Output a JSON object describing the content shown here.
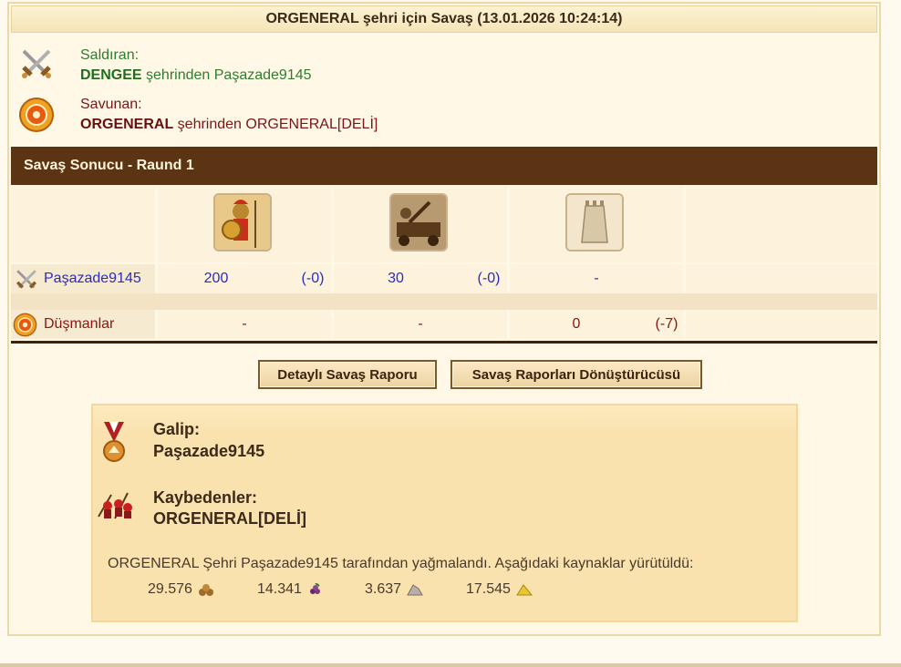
{
  "title": "ORGENERAL şehri için Savaş (13.01.2026 10:24:14)",
  "attacker": {
    "role": "Saldıran:",
    "city": "DENGEE",
    "middle": " şehrinden ",
    "player": "Paşazade9145"
  },
  "defender": {
    "role": "Savunan:",
    "city": "ORGENERAL",
    "middle": " şehrinden ",
    "player": "ORGENERAL[DELİ]"
  },
  "round_title": "Savaş Sonucu - Raund 1",
  "units": [
    {
      "icon": "hoplite-unit-icon"
    },
    {
      "icon": "catapult-unit-icon"
    },
    {
      "icon": "wall-unit-icon"
    }
  ],
  "rows": {
    "attacker_name": "Paşazade9145",
    "attacker_values": [
      {
        "count": "200",
        "loss": "(-0)"
      },
      {
        "count": "30",
        "loss": "(-0)"
      },
      {
        "count": "-",
        "loss": ""
      }
    ],
    "enemy_name": "Düşmanlar",
    "enemy_values": [
      {
        "count": "-",
        "loss": ""
      },
      {
        "count": "-",
        "loss": ""
      },
      {
        "count": "0",
        "loss": "(-7)"
      }
    ]
  },
  "buttons": {
    "detailed_report": "Detaylı Savaş Raporu",
    "converter": "Savaş Raporları Dönüştürücüsü"
  },
  "result": {
    "winner_label": "Galip:",
    "winner": "Paşazade9145",
    "losers_label": "Kaybedenler:",
    "losers": "ORGENERAL[DELİ]",
    "plunder_text": "ORGENERAL Şehri Paşazade9145 tarafından yağmalandı. Aşağıdaki kaynaklar yürütüldü:",
    "resources": [
      {
        "value": "29.576",
        "icon": "wood-icon"
      },
      {
        "value": "14.341",
        "icon": "wine-icon"
      },
      {
        "value": "3.637",
        "icon": "marble-icon"
      },
      {
        "value": "17.545",
        "icon": "sulfur-icon"
      }
    ]
  },
  "colors": {
    "header_brown": "#5a3413",
    "attacker_green": "#2e7d2e",
    "defender_red": "#7a1515",
    "unit_blue": "#2b2bbf"
  }
}
